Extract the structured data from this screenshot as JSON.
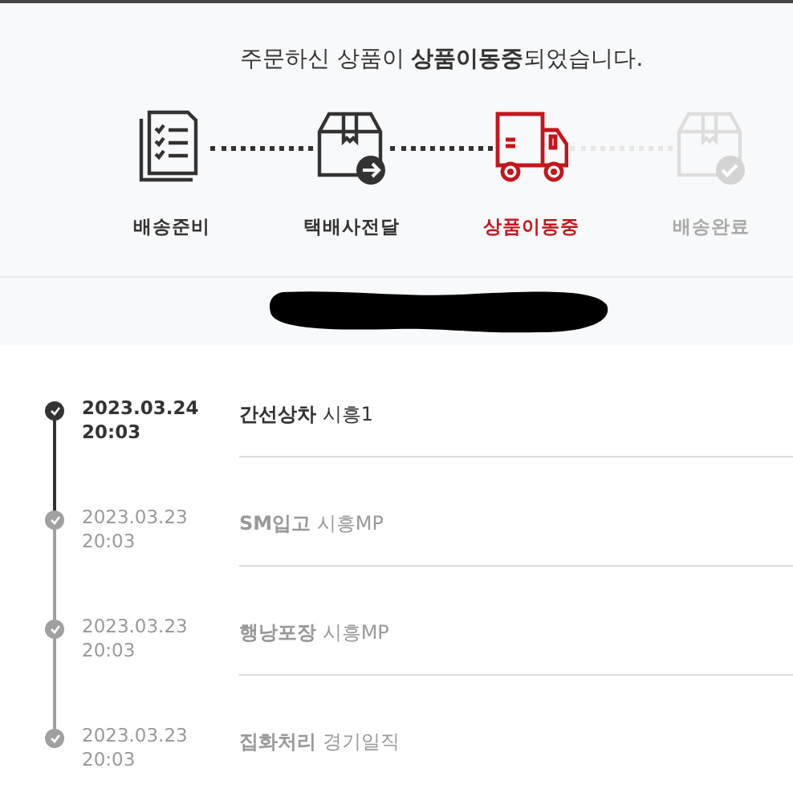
{
  "headline": "주문하신 상품이 **상품이동중**되었습니다.",
  "steps": [
    {
      "kind": "checklist",
      "label": "배송준비",
      "reached": true,
      "selected": false
    },
    {
      "kind": "handover",
      "label": "택배사전달",
      "reached": true,
      "selected": false
    },
    {
      "kind": "truck",
      "label": "상품이동중",
      "reached": true,
      "selected": true
    },
    {
      "kind": "delivered",
      "label": "배송완료",
      "reached": false,
      "selected": false
    }
  ],
  "events": [
    {
      "date": "2023.03.24",
      "time": "20:03",
      "text": "**간선상차** 시흥1",
      "latest": true
    },
    {
      "date": "2023.03.23",
      "time": "20:03",
      "text": "**SM입고** 시흥MP",
      "latest": false
    },
    {
      "date": "2023.03.23",
      "time": "20:03",
      "text": "**행낭포장** 시흥MP",
      "latest": false
    },
    {
      "date": "2023.03.23",
      "time": "20:03",
      "text": "**집화처리** 경기일직",
      "latest": false
    }
  ]
}
